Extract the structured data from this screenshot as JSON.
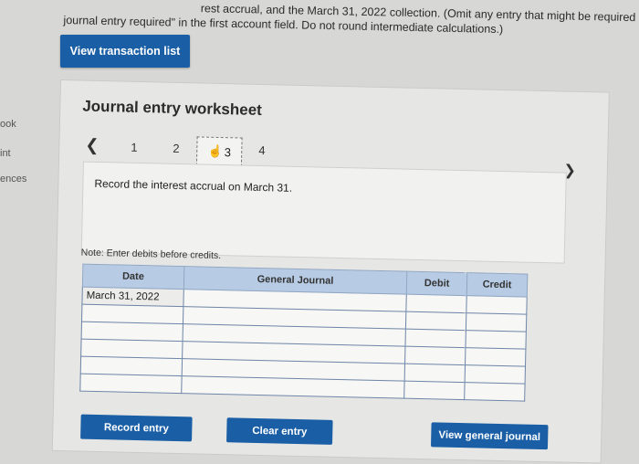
{
  "instructions": {
    "line1": "rest accrual, and the March 31, 2022 collection. (Omit any entry that might be required for the",
    "line2": "journal entry required\" in the first account field. Do not round intermediate calculations.)"
  },
  "side_nav": [
    "ook",
    "int",
    "ences"
  ],
  "view_transaction_list": "View transaction list",
  "worksheet": {
    "title": "Journal entry worksheet",
    "pages": [
      "1",
      "2",
      "3",
      "4"
    ],
    "active_page": "3",
    "instruction": "Record the interest accrual on March 31.",
    "note": "Note: Enter debits before credits.",
    "columns": [
      "Date",
      "General Journal",
      "Debit",
      "Credit"
    ],
    "rows": [
      {
        "date": "March 31, 2022",
        "account": "",
        "debit": "",
        "credit": ""
      },
      {
        "date": "",
        "account": "",
        "debit": "",
        "credit": ""
      },
      {
        "date": "",
        "account": "",
        "debit": "",
        "credit": ""
      },
      {
        "date": "",
        "account": "",
        "debit": "",
        "credit": ""
      },
      {
        "date": "",
        "account": "",
        "debit": "",
        "credit": ""
      },
      {
        "date": "",
        "account": "",
        "debit": "",
        "credit": ""
      }
    ],
    "buttons": {
      "record": "Record entry",
      "clear": "Clear entry",
      "view_gj": "View general journal"
    }
  },
  "icons": {
    "prev": "chevron-left-icon",
    "next": "chevron-right-icon",
    "cursor": "hand-pointer-icon"
  },
  "colors": {
    "primary_button": "#1a5fa6",
    "table_header": "#b7cbe4"
  }
}
